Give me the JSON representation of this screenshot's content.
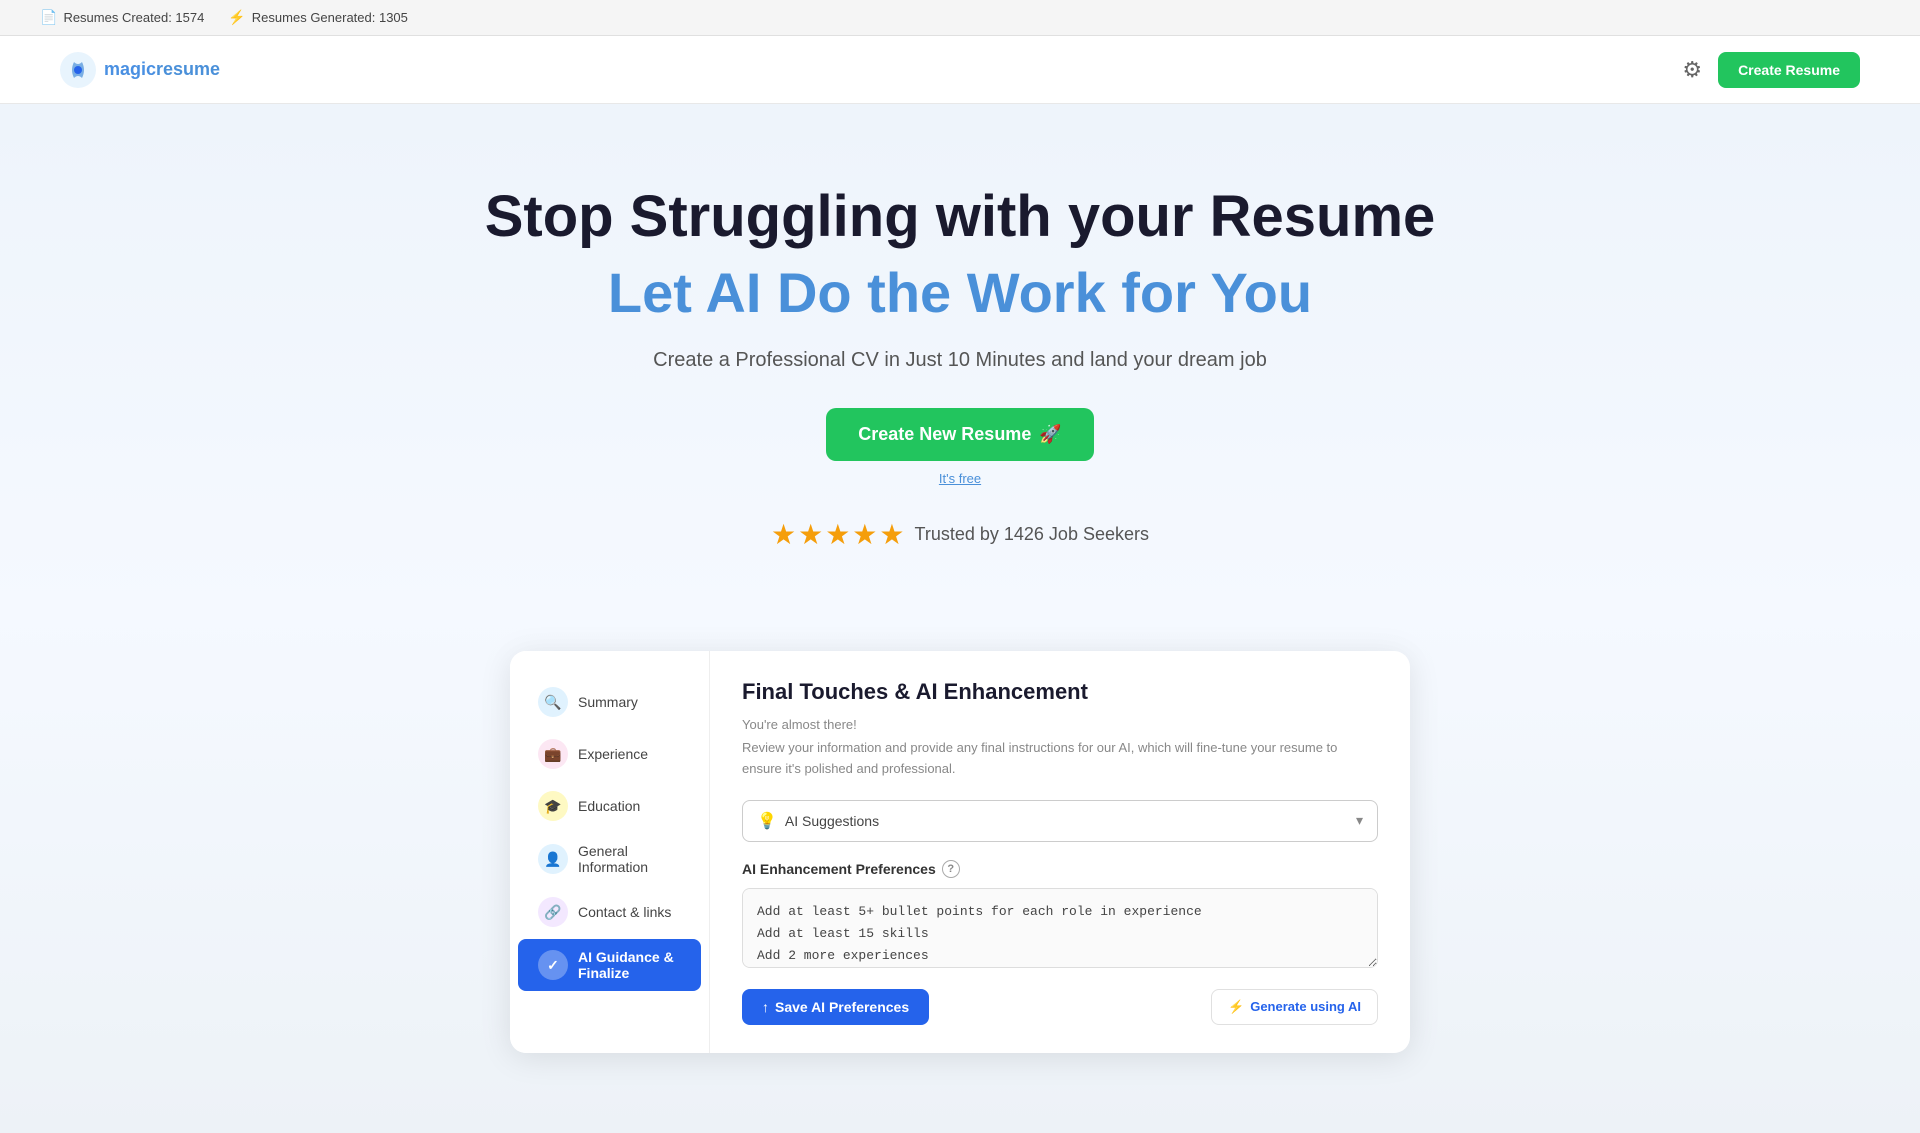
{
  "topbar": {
    "resumes_created_label": "Resumes Created: 1574",
    "resumes_generated_label": "Resumes Generated: 1305"
  },
  "navbar": {
    "logo_text_magic": "magic",
    "logo_text_resume": "resume",
    "create_resume_label": "Create Resume"
  },
  "hero": {
    "headline1": "Stop Struggling with your Resume",
    "headline2": "Let AI Do the Work for You",
    "subtext": "Create a Professional CV in Just 10 Minutes and land your dream job",
    "cta_label": "Create New Resume",
    "cta_icon": "🚀",
    "free_label": "It's free",
    "stars": "★★★★★",
    "trusted_text": "Trusted by 1426 Job Seekers"
  },
  "sidebar": {
    "items": [
      {
        "id": "summary",
        "label": "Summary",
        "icon": "🔍"
      },
      {
        "id": "experience",
        "label": "Experience",
        "icon": "💼"
      },
      {
        "id": "education",
        "label": "Education",
        "icon": "🎓"
      },
      {
        "id": "general",
        "label": "General Information",
        "icon": "👤"
      },
      {
        "id": "contact",
        "label": "Contact & links",
        "icon": "🔗"
      },
      {
        "id": "ai",
        "label": "AI Guidance & Finalize",
        "icon": "✓",
        "active": true
      }
    ]
  },
  "main_card": {
    "title": "Final Touches & AI Enhancement",
    "desc1": "You're almost there!",
    "desc2": "Review your information and provide any final instructions for our AI, which will fine-tune your resume to ensure it's polished and professional.",
    "ai_suggestions_placeholder": "AI Suggestions",
    "pref_label": "AI Enhancement Preferences",
    "pref_text": "Add at least 5+ bullet points for each role in experience\nAdd at least 15 skills\nAdd 2 more experiences\nInclude measurable achievements and quantify my impact in each role",
    "save_btn_label": "Save AI Preferences",
    "save_btn_icon": "↑",
    "generate_btn_label": "Generate using AI",
    "generate_btn_icon": "⚡"
  }
}
